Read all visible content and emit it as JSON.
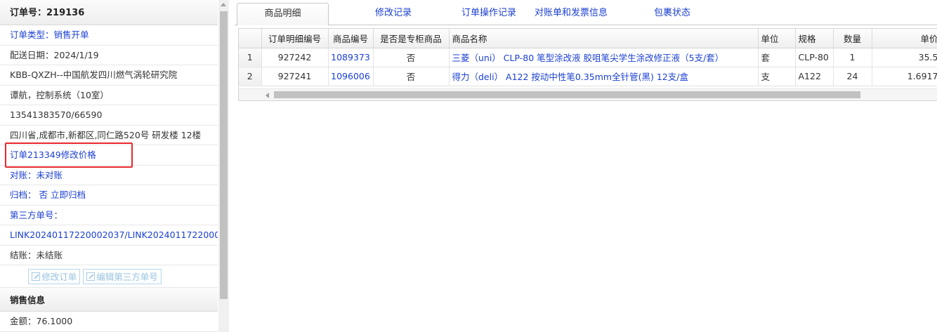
{
  "order": {
    "title": "订单号：219136",
    "fields": [
      {
        "id": "type",
        "text": "订单类型：销售开单",
        "style": "blue"
      },
      {
        "id": "delivery_date",
        "text": "配送日期：2024/1/19",
        "style": "dark"
      },
      {
        "id": "customer",
        "text": "KBB-QXZH--中国航发四川燃气涡轮研究院",
        "style": "dark"
      },
      {
        "id": "contact",
        "text": "谭航，控制系统（10室）",
        "style": "dark"
      },
      {
        "id": "phone",
        "text": "13541383570/66590",
        "style": "dark"
      },
      {
        "id": "address",
        "text": "四川省,成都市,新都区,同仁路520号 研发楼 12楼",
        "style": "dark"
      },
      {
        "id": "price_change",
        "text": "订单213349修改价格",
        "style": "blue"
      },
      {
        "id": "reconcile",
        "text": "对账：未对账",
        "style": "blue"
      },
      {
        "id": "archive",
        "text": "归档：  否 立即归档",
        "style": "blue"
      },
      {
        "id": "third_party_label",
        "text": "第三方单号：",
        "style": "blue"
      },
      {
        "id": "third_party_value",
        "text": "LINK20240117220002037/LINK20240117220002038",
        "style": "blue"
      },
      {
        "id": "settle",
        "text": "结账：未结账",
        "style": "dark"
      }
    ],
    "edit_order_label": "修改订单",
    "edit_third_party_label": "编辑第三方单号"
  },
  "sales": {
    "title": "销售信息",
    "amount": "金额：76.1000"
  },
  "tabs": [
    {
      "label": "商品明细",
      "active": true
    },
    {
      "label": "修改记录",
      "active": false
    },
    {
      "label": "订单操作记录",
      "active": false
    },
    {
      "label": "对账单和发票信息",
      "active": false
    },
    {
      "label": "包裹状态",
      "active": false
    }
  ],
  "grid": {
    "columns": [
      "",
      "订单明细编号",
      "商品编号",
      "是否是专柜商品",
      "商品名称",
      "单位",
      "规格",
      "数量",
      "单价"
    ],
    "rows": [
      {
        "idx": "1",
        "detail_no": "927242",
        "product_no": "1089373",
        "counter": "否",
        "name": "三菱（uni） CLP-80 笔型涂改液 胶咀笔尖学生涂改修正液（5支/套）",
        "unit": "套",
        "spec": "CLP-80",
        "qty": "1",
        "price": "35.5"
      },
      {
        "idx": "2",
        "detail_no": "927241",
        "product_no": "1096006",
        "counter": "否",
        "name": "得力（deli） A122 按动中性笔0.35mm全针管(黑) 12支/盒",
        "unit": "支",
        "spec": "A122",
        "qty": "24",
        "price": "1.6917"
      }
    ]
  }
}
